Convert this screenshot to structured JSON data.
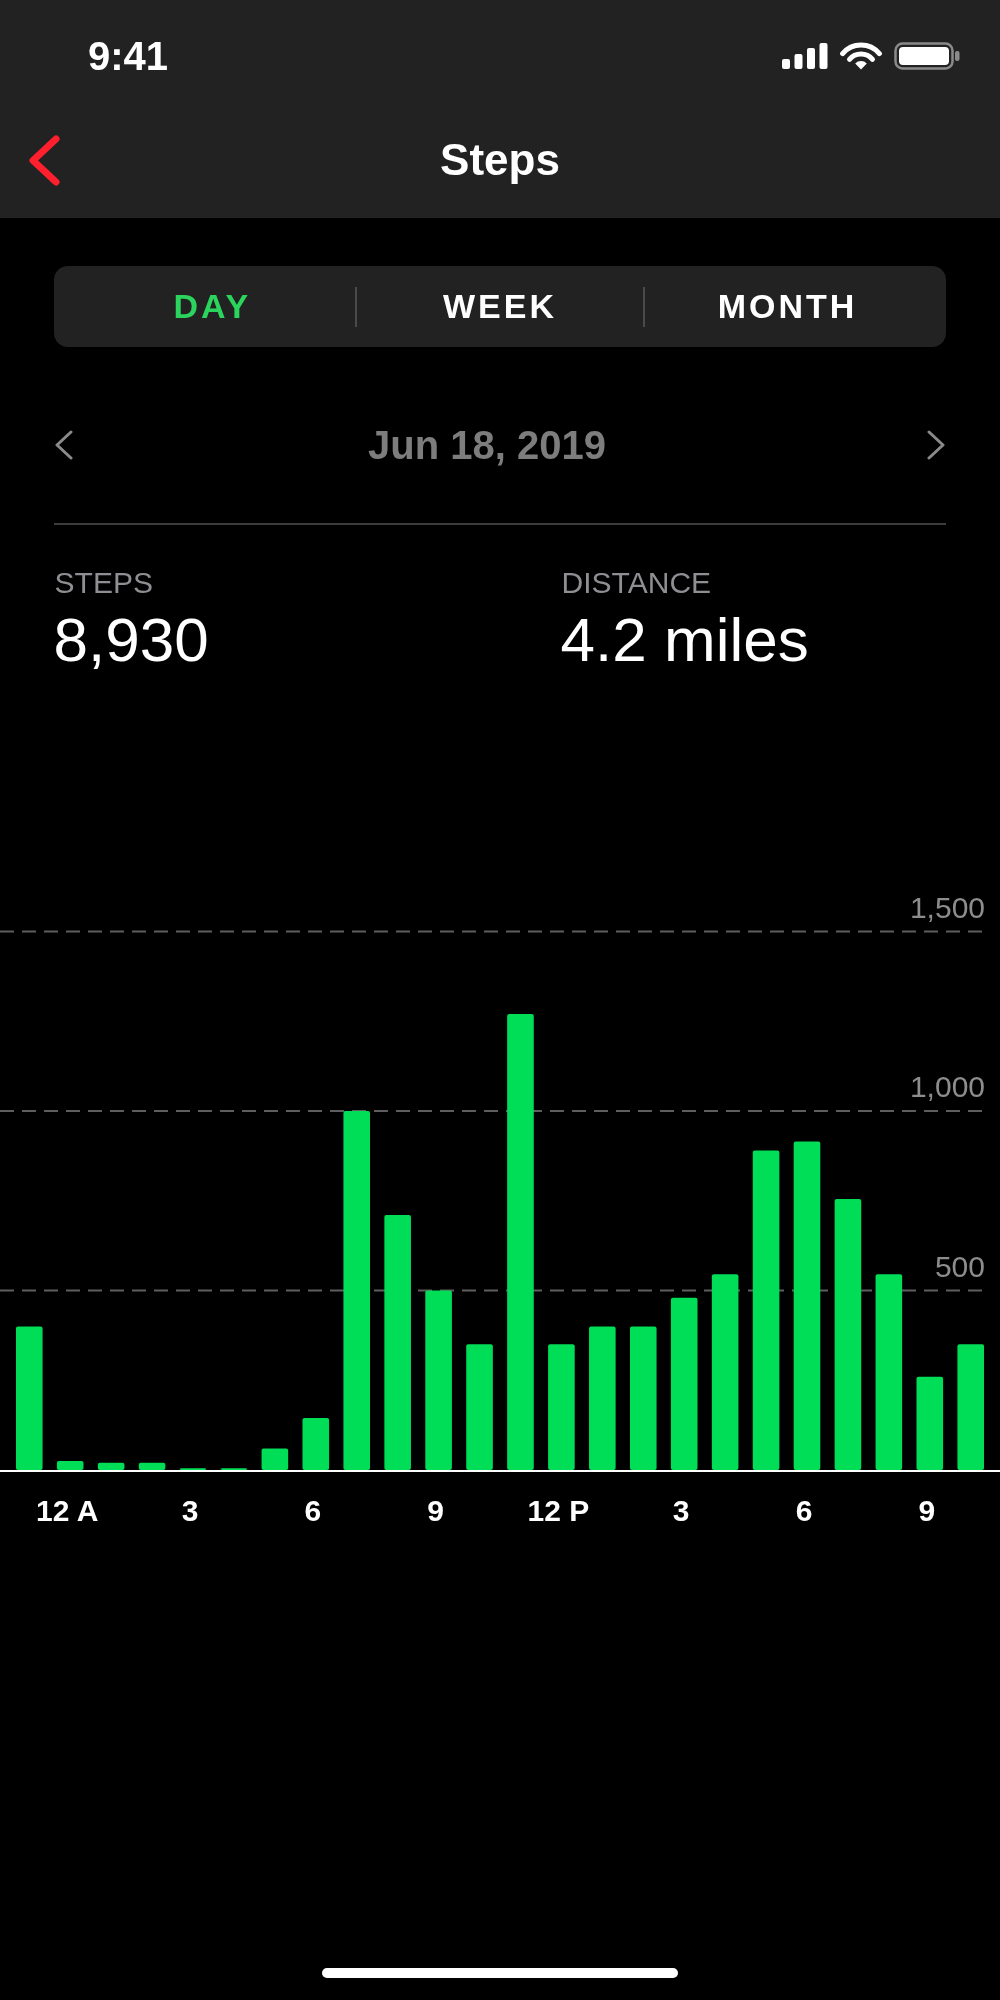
{
  "status_bar": {
    "time": "9:41"
  },
  "nav_bar": {
    "title": "Steps"
  },
  "tabs": [
    {
      "label": "DAY",
      "selected": true
    },
    {
      "label": "WEEK",
      "selected": false
    },
    {
      "label": "MONTH",
      "selected": false
    }
  ],
  "date_nav": {
    "date": "Jun 18, 2019"
  },
  "stats": [
    {
      "label": "STEPS",
      "value": "8,930"
    },
    {
      "label": "DISTANCE",
      "value": "4.2 miles"
    }
  ],
  "chart": {
    "chart_data": {
      "type": "bar",
      "categories": [
        null,
        "12 A",
        null,
        null,
        "3",
        null,
        null,
        "6",
        null,
        null,
        "9",
        null,
        null,
        "12 P",
        null,
        null,
        "3",
        null,
        null,
        "6",
        null,
        null,
        "9",
        null
      ],
      "values": [
        400,
        25,
        20,
        20,
        5,
        5,
        60,
        145,
        1000,
        710,
        500,
        350,
        1270,
        350,
        400,
        400,
        480,
        545,
        890,
        915,
        755,
        545,
        260,
        350
      ],
      "ylim": [
        0,
        1500
      ],
      "yticks": [
        {
          "value": 500,
          "label": "500"
        },
        {
          "value": 1000,
          "label": "1,000"
        },
        {
          "value": 1500,
          "label": "1,500"
        }
      ]
    }
  }
}
